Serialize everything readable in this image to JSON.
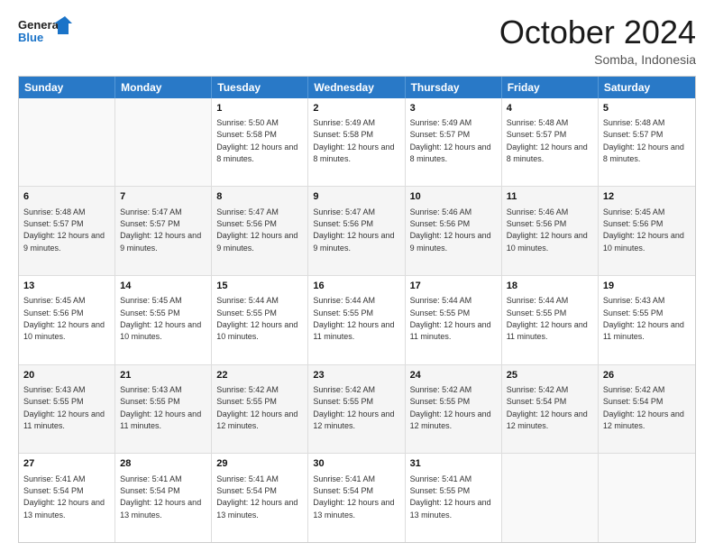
{
  "logo": {
    "text_general": "General",
    "text_blue": "Blue"
  },
  "header": {
    "month": "October 2024",
    "location": "Somba, Indonesia"
  },
  "weekdays": [
    "Sunday",
    "Monday",
    "Tuesday",
    "Wednesday",
    "Thursday",
    "Friday",
    "Saturday"
  ],
  "weeks": [
    {
      "alt": false,
      "days": [
        {
          "num": "",
          "sunrise": "",
          "sunset": "",
          "daylight": ""
        },
        {
          "num": "",
          "sunrise": "",
          "sunset": "",
          "daylight": ""
        },
        {
          "num": "1",
          "sunrise": "Sunrise: 5:50 AM",
          "sunset": "Sunset: 5:58 PM",
          "daylight": "Daylight: 12 hours and 8 minutes."
        },
        {
          "num": "2",
          "sunrise": "Sunrise: 5:49 AM",
          "sunset": "Sunset: 5:58 PM",
          "daylight": "Daylight: 12 hours and 8 minutes."
        },
        {
          "num": "3",
          "sunrise": "Sunrise: 5:49 AM",
          "sunset": "Sunset: 5:57 PM",
          "daylight": "Daylight: 12 hours and 8 minutes."
        },
        {
          "num": "4",
          "sunrise": "Sunrise: 5:48 AM",
          "sunset": "Sunset: 5:57 PM",
          "daylight": "Daylight: 12 hours and 8 minutes."
        },
        {
          "num": "5",
          "sunrise": "Sunrise: 5:48 AM",
          "sunset": "Sunset: 5:57 PM",
          "daylight": "Daylight: 12 hours and 8 minutes."
        }
      ]
    },
    {
      "alt": true,
      "days": [
        {
          "num": "6",
          "sunrise": "Sunrise: 5:48 AM",
          "sunset": "Sunset: 5:57 PM",
          "daylight": "Daylight: 12 hours and 9 minutes."
        },
        {
          "num": "7",
          "sunrise": "Sunrise: 5:47 AM",
          "sunset": "Sunset: 5:57 PM",
          "daylight": "Daylight: 12 hours and 9 minutes."
        },
        {
          "num": "8",
          "sunrise": "Sunrise: 5:47 AM",
          "sunset": "Sunset: 5:56 PM",
          "daylight": "Daylight: 12 hours and 9 minutes."
        },
        {
          "num": "9",
          "sunrise": "Sunrise: 5:47 AM",
          "sunset": "Sunset: 5:56 PM",
          "daylight": "Daylight: 12 hours and 9 minutes."
        },
        {
          "num": "10",
          "sunrise": "Sunrise: 5:46 AM",
          "sunset": "Sunset: 5:56 PM",
          "daylight": "Daylight: 12 hours and 9 minutes."
        },
        {
          "num": "11",
          "sunrise": "Sunrise: 5:46 AM",
          "sunset": "Sunset: 5:56 PM",
          "daylight": "Daylight: 12 hours and 10 minutes."
        },
        {
          "num": "12",
          "sunrise": "Sunrise: 5:45 AM",
          "sunset": "Sunset: 5:56 PM",
          "daylight": "Daylight: 12 hours and 10 minutes."
        }
      ]
    },
    {
      "alt": false,
      "days": [
        {
          "num": "13",
          "sunrise": "Sunrise: 5:45 AM",
          "sunset": "Sunset: 5:56 PM",
          "daylight": "Daylight: 12 hours and 10 minutes."
        },
        {
          "num": "14",
          "sunrise": "Sunrise: 5:45 AM",
          "sunset": "Sunset: 5:55 PM",
          "daylight": "Daylight: 12 hours and 10 minutes."
        },
        {
          "num": "15",
          "sunrise": "Sunrise: 5:44 AM",
          "sunset": "Sunset: 5:55 PM",
          "daylight": "Daylight: 12 hours and 10 minutes."
        },
        {
          "num": "16",
          "sunrise": "Sunrise: 5:44 AM",
          "sunset": "Sunset: 5:55 PM",
          "daylight": "Daylight: 12 hours and 11 minutes."
        },
        {
          "num": "17",
          "sunrise": "Sunrise: 5:44 AM",
          "sunset": "Sunset: 5:55 PM",
          "daylight": "Daylight: 12 hours and 11 minutes."
        },
        {
          "num": "18",
          "sunrise": "Sunrise: 5:44 AM",
          "sunset": "Sunset: 5:55 PM",
          "daylight": "Daylight: 12 hours and 11 minutes."
        },
        {
          "num": "19",
          "sunrise": "Sunrise: 5:43 AM",
          "sunset": "Sunset: 5:55 PM",
          "daylight": "Daylight: 12 hours and 11 minutes."
        }
      ]
    },
    {
      "alt": true,
      "days": [
        {
          "num": "20",
          "sunrise": "Sunrise: 5:43 AM",
          "sunset": "Sunset: 5:55 PM",
          "daylight": "Daylight: 12 hours and 11 minutes."
        },
        {
          "num": "21",
          "sunrise": "Sunrise: 5:43 AM",
          "sunset": "Sunset: 5:55 PM",
          "daylight": "Daylight: 12 hours and 11 minutes."
        },
        {
          "num": "22",
          "sunrise": "Sunrise: 5:42 AM",
          "sunset": "Sunset: 5:55 PM",
          "daylight": "Daylight: 12 hours and 12 minutes."
        },
        {
          "num": "23",
          "sunrise": "Sunrise: 5:42 AM",
          "sunset": "Sunset: 5:55 PM",
          "daylight": "Daylight: 12 hours and 12 minutes."
        },
        {
          "num": "24",
          "sunrise": "Sunrise: 5:42 AM",
          "sunset": "Sunset: 5:55 PM",
          "daylight": "Daylight: 12 hours and 12 minutes."
        },
        {
          "num": "25",
          "sunrise": "Sunrise: 5:42 AM",
          "sunset": "Sunset: 5:54 PM",
          "daylight": "Daylight: 12 hours and 12 minutes."
        },
        {
          "num": "26",
          "sunrise": "Sunrise: 5:42 AM",
          "sunset": "Sunset: 5:54 PM",
          "daylight": "Daylight: 12 hours and 12 minutes."
        }
      ]
    },
    {
      "alt": false,
      "days": [
        {
          "num": "27",
          "sunrise": "Sunrise: 5:41 AM",
          "sunset": "Sunset: 5:54 PM",
          "daylight": "Daylight: 12 hours and 13 minutes."
        },
        {
          "num": "28",
          "sunrise": "Sunrise: 5:41 AM",
          "sunset": "Sunset: 5:54 PM",
          "daylight": "Daylight: 12 hours and 13 minutes."
        },
        {
          "num": "29",
          "sunrise": "Sunrise: 5:41 AM",
          "sunset": "Sunset: 5:54 PM",
          "daylight": "Daylight: 12 hours and 13 minutes."
        },
        {
          "num": "30",
          "sunrise": "Sunrise: 5:41 AM",
          "sunset": "Sunset: 5:54 PM",
          "daylight": "Daylight: 12 hours and 13 minutes."
        },
        {
          "num": "31",
          "sunrise": "Sunrise: 5:41 AM",
          "sunset": "Sunset: 5:55 PM",
          "daylight": "Daylight: 12 hours and 13 minutes."
        },
        {
          "num": "",
          "sunrise": "",
          "sunset": "",
          "daylight": ""
        },
        {
          "num": "",
          "sunrise": "",
          "sunset": "",
          "daylight": ""
        }
      ]
    }
  ]
}
